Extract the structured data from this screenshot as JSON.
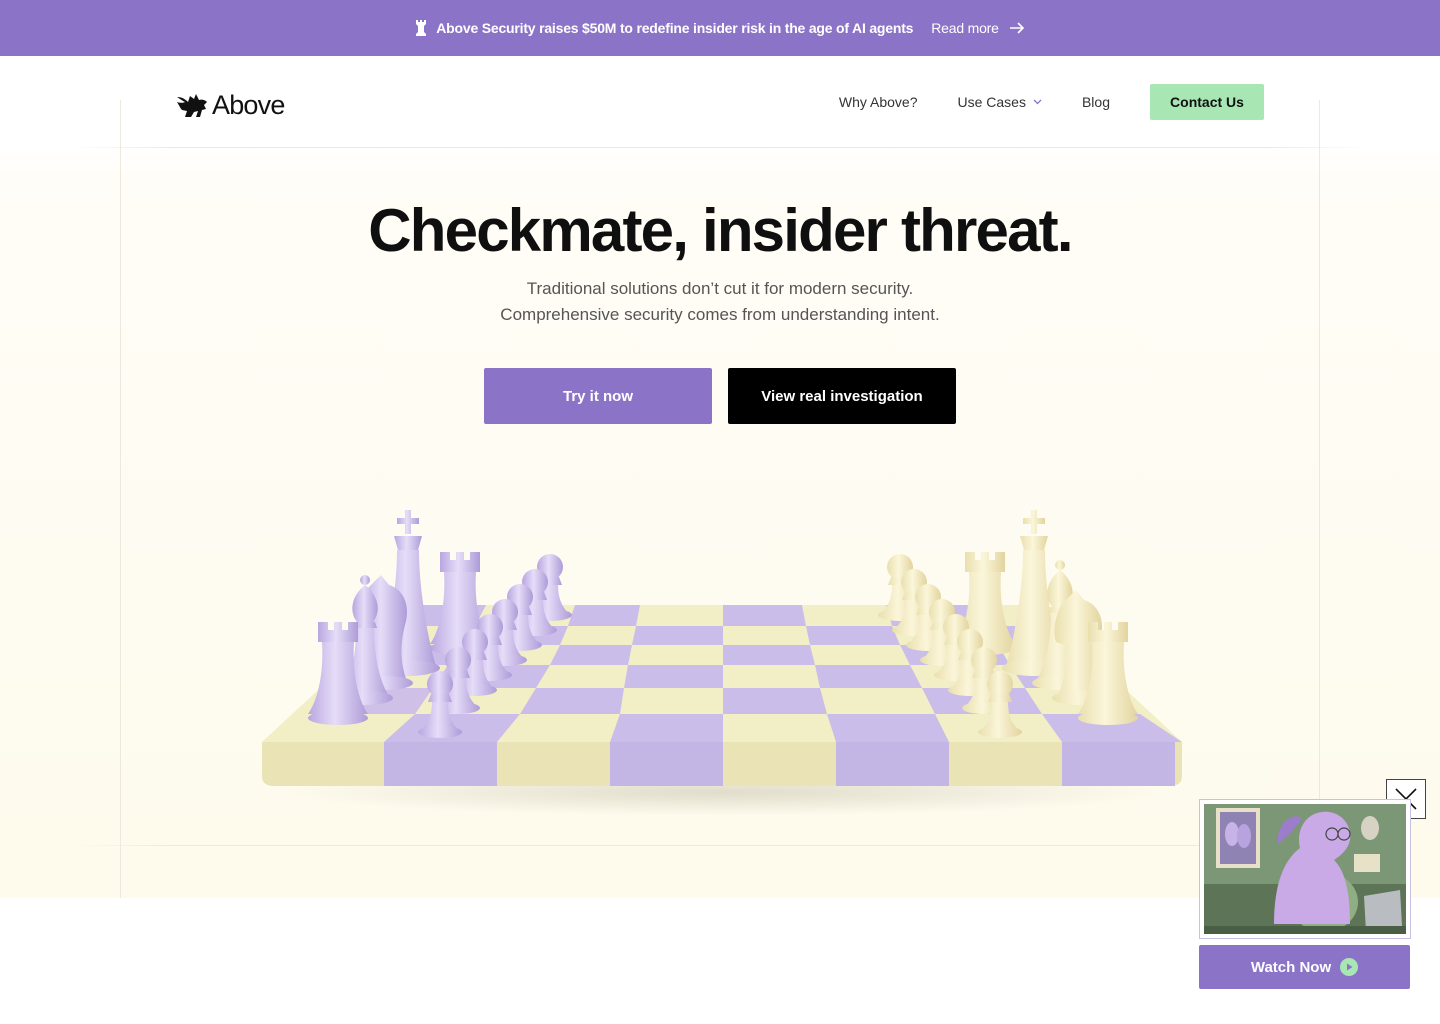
{
  "announcement": {
    "text": "Above Security raises $50M to redefine insider risk in the age of AI agents",
    "link_label": "Read more"
  },
  "header": {
    "brand": "Above",
    "nav": {
      "why": "Why Above?",
      "use_cases": "Use Cases",
      "blog": "Blog"
    },
    "contact_label": "Contact Us"
  },
  "hero": {
    "headline": "Checkmate, insider threat.",
    "subline_1": "Traditional solutions don’t cut it for modern security.",
    "subline_2": "Comprehensive security comes from understanding intent.",
    "primary_cta": "Try it now",
    "secondary_cta": "View real investigation"
  },
  "video_popup": {
    "watch_label": "Watch Now"
  },
  "colors": {
    "brand_purple": "#8b74c8",
    "contact_green": "#a8e6b4",
    "board_cream": "#f2eec6",
    "board_lavender": "#c9bde9",
    "piece_white": "#f3ecc4",
    "piece_purple": "#cbbde9"
  },
  "icons": {
    "announcement": "rook-icon",
    "read_more": "arrow-right-icon",
    "use_cases": "chevron-down-icon",
    "close": "close-icon",
    "play": "play-icon"
  }
}
